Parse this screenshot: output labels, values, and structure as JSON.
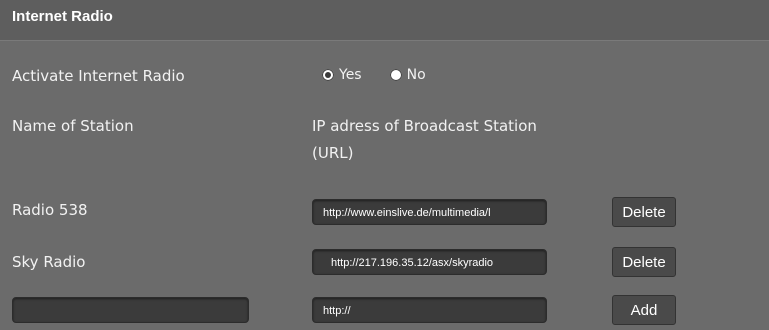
{
  "section": {
    "title": "Internet Radio"
  },
  "activate": {
    "label": "Activate Internet Radio",
    "options": [
      {
        "label": "Yes",
        "selected": true
      },
      {
        "label": "No",
        "selected": false
      }
    ]
  },
  "table": {
    "name_header": "Name of Station",
    "url_header_line1": "IP adress of Broadcast Station",
    "url_header_line2": "(URL)"
  },
  "stations": [
    {
      "name": "Radio 538",
      "url": "http://www.einslive.de/multimedia/l",
      "action": "Delete"
    },
    {
      "name": "Sky Radio",
      "url": "http://217.196.35.12/asx/skyradio",
      "action": "Delete"
    }
  ],
  "new_station": {
    "name_value": "",
    "url_value": "http://",
    "action": "Add"
  }
}
